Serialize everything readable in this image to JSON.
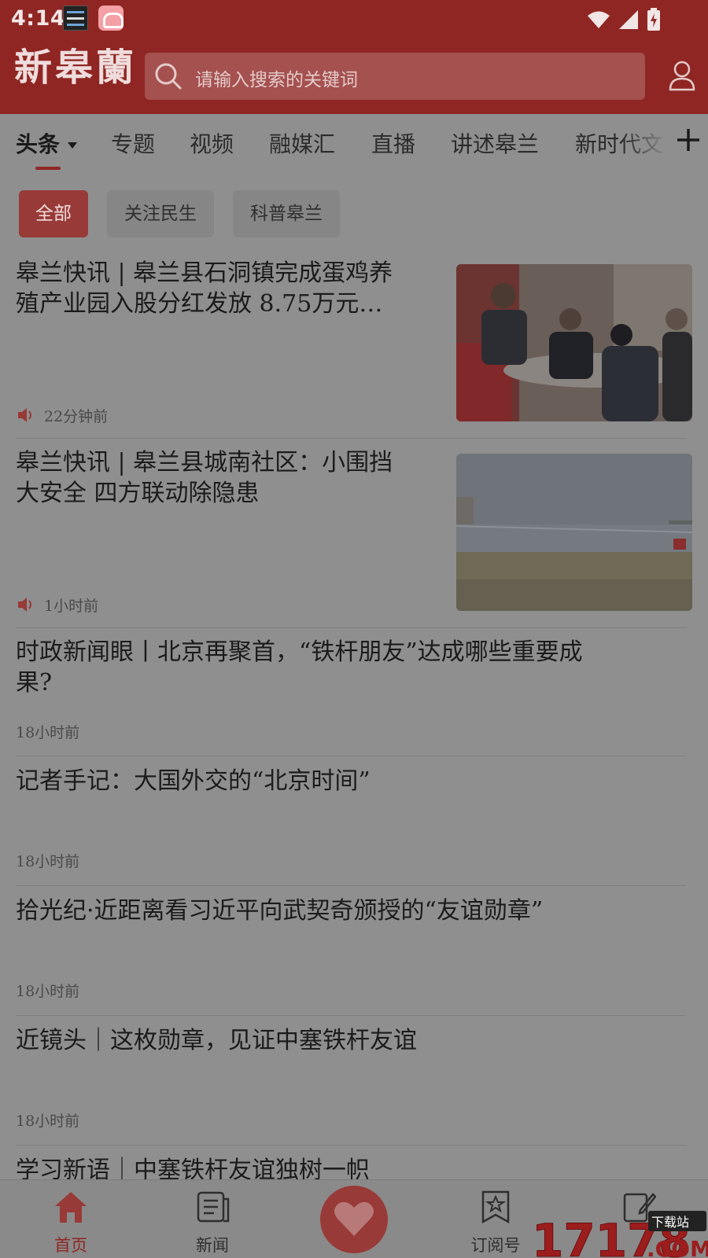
{
  "status_bar": {
    "time": "4:14"
  },
  "header": {
    "logo": "新皋蘭",
    "search_placeholder": "请输入搜索的关键词"
  },
  "tabs": [
    {
      "label": "头条",
      "active": true
    },
    {
      "label": "专题"
    },
    {
      "label": "视频"
    },
    {
      "label": "融媒汇"
    },
    {
      "label": "直播"
    },
    {
      "label": "讲述皋兰"
    },
    {
      "label": "新时代文"
    }
  ],
  "chips": [
    {
      "label": "全部",
      "active": true
    },
    {
      "label": "关注民生"
    },
    {
      "label": "科普皋兰"
    }
  ],
  "news": [
    {
      "title_l1": "皋兰快讯 | 皋兰县石洞镇完成蛋鸡养",
      "title_l2": "殖产业园入股分红发放  8.75万元…",
      "time": "22分钟前",
      "audio": true
    },
    {
      "title_l1": "皋兰快讯 | 皋兰县城南社区：小围挡",
      "title_l2": "大安全 四方联动除隐患",
      "time": "1小时前",
      "audio": true
    },
    {
      "title_l1": "时政新闻眼丨北京再聚首，“铁杆朋友”达成哪些重要成",
      "title_l2": "果?",
      "time": "18小时前"
    },
    {
      "title_l1": "记者手记：大国外交的“北京时间”",
      "time": "18小时前"
    },
    {
      "title_l1": "拾光纪·近距离看习近平向武契奇颁授的“友谊勋章”",
      "time": "18小时前"
    },
    {
      "title_l1": "近镜头｜这枚勋章，见证中塞铁杆友谊",
      "time": "18小时前"
    },
    {
      "title_l1": "学习新语｜中塞铁杆友谊独树一帜"
    }
  ],
  "bottom_nav": [
    {
      "label": "首页",
      "icon": "home-icon",
      "active": true
    },
    {
      "label": "新闻",
      "icon": "news-icon"
    },
    {
      "label": "订阅号",
      "icon": "subscribe-icon"
    }
  ],
  "watermark": {
    "text": "17178",
    "suffix": ".COM",
    "badge": "下载站"
  },
  "colors": {
    "brand_red": "#8f2623",
    "overlay_gray": "#8f8f8f"
  }
}
